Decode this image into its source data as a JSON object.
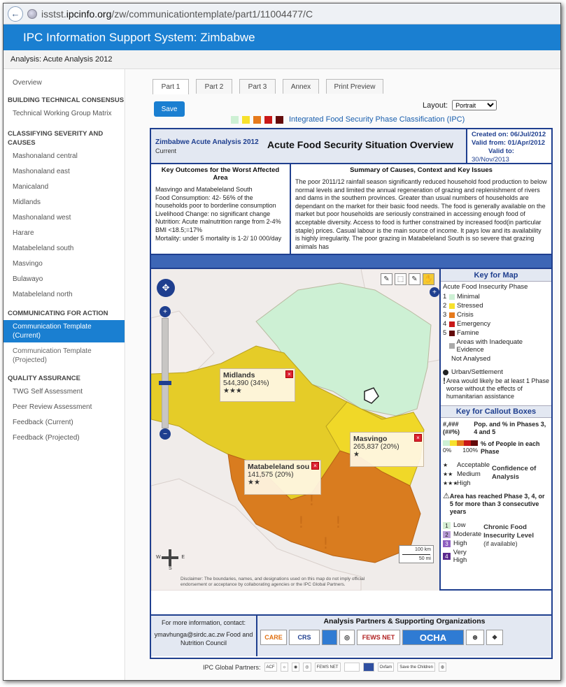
{
  "browser": {
    "url_prefix": "isstst.",
    "url_domain": "ipcinfo.org",
    "url_path": "/zw/communicationtemplate/part1/11004477/C"
  },
  "app": {
    "title": "IPC Information Support System: Zimbabwe",
    "analysis": "Analysis: Acute Analysis 2012"
  },
  "sidebar": {
    "overview": "Overview",
    "sections": [
      {
        "heading": "BUILDING TECHNICAL CONSENSUS",
        "items": [
          "Technical Working Group Matrix"
        ]
      },
      {
        "heading": "CLASSIFYING SEVERITY AND CAUSES",
        "items": [
          "Mashonaland central",
          "Mashonaland east",
          "Manicaland",
          "Midlands",
          "Mashonaland west",
          "Harare",
          "Matabeleland south",
          "Masvingo",
          "Bulawayo",
          "Matabeleland north"
        ]
      },
      {
        "heading": "COMMUNICATING FOR ACTION",
        "active": "Communication Template",
        "active_sub": "(Current)",
        "item2": "Communication Template",
        "item2_sub": "(Projected)"
      },
      {
        "heading": "QUALITY ASSURANCE",
        "items": [
          "TWG Self Assessment",
          "Peer Review Assessment",
          "Feedback (Current)",
          "Feedback (Projected)"
        ]
      }
    ]
  },
  "tabs": [
    "Part 1",
    "Part 2",
    "Part 3",
    "Annex",
    "Print Preview"
  ],
  "save": "Save",
  "layout": {
    "label": "Layout:",
    "value": "Portrait"
  },
  "ipc_title": "Integrated Food Security Phase Classification (IPC)",
  "phase_colors": [
    "#cdf0d4",
    "#f7e12c",
    "#e67a1c",
    "#c91818",
    "#640b0b"
  ],
  "doc": {
    "left_title": "Zimbabwe Acute Analysis 2012",
    "left_sub": "Current",
    "title": "Acute Food Security Situation Overview",
    "created": "Created on: 06/Jul/2012",
    "valid_from": "Valid from: 01/Apr/2012",
    "valid_to": "Valid to:",
    "valid_to_date": "30/Nov/2013",
    "key_outcomes_h": "Key Outcomes for the Worst Affected Area",
    "key_outcomes": [
      "Masvingo and Matabeleland South",
      "Food Consumption: 42- 56% of the households poor to borderline consumption",
      "Livelihood Change: no significant change",
      "Nutrition: Acute malnutrition range from 2-4% BMI <18.5;=17%",
      "Mortality: under 5 mortality is 1-2/ 10 000/day"
    ],
    "summary_h": "Summary of Causes, Context and Key Issues",
    "summary": "The poor 2011/12 rainfall season significantly reduced household food production to below normal levels and limited the annual regeneration of grazing and replenishment of rivers and dams in the southern provinces. Greater than usual numbers of households are dependant on the market for their basic food needs. The food is generally available on the market but poor households are seriously constrained in accessing enough food of acceptable diversity. Access to food is further constrained by increased food(in particular staple) prices. Casual labour is the main source of income. It pays low and its availability is highly irregularity. The poor grazing in Matabeleland South is so severe that grazing animals has"
  },
  "callouts": [
    {
      "name": "Midlands",
      "value": "544,390 (34%)",
      "stars": "★★★"
    },
    {
      "name": "Masvingo",
      "value": "265,837 (20%)",
      "stars": "★"
    },
    {
      "name": "Matabeleland sou ...",
      "value": "141,575 (20%)",
      "stars": "★★"
    }
  ],
  "map": {
    "disclaimer": "Disclaimer: The boundaries, names, and designations used on this map do not imply official endorsement or acceptance by collaborating agencies or the IPC Global Partners.",
    "scale_km": "100 km",
    "scale_mi": "50 mi",
    "compass": {
      "w": "W",
      "e": "E",
      "s": "S"
    }
  },
  "legend": {
    "title": "Key for Map",
    "subtitle": "Acute Food Insecurity Phase",
    "phases": [
      {
        "n": "1",
        "label": "Minimal"
      },
      {
        "n": "2",
        "label": "Stressed"
      },
      {
        "n": "3",
        "label": "Crisis"
      },
      {
        "n": "4",
        "label": "Emergency"
      },
      {
        "n": "5",
        "label": "Famine"
      }
    ],
    "inadequate": "Areas with Inadequate Evidence",
    "not_analysed": "Not Analysed",
    "urban": "Urban/Settlement",
    "worse": "Area would likely be at least 1 Phase worse without the effects of humanitarian assistance",
    "callout_title": "Key for Callout Boxes",
    "pop_code": "#,### (##%)",
    "pop_label": "Pop. and % in Phases 3, 4 and 5",
    "pct_label": "% of People in each Phase",
    "pct_min": "0%",
    "pct_max": "100%",
    "conf": [
      {
        "s": "★",
        "l": "Acceptable"
      },
      {
        "s": "★★",
        "l": "Medium"
      },
      {
        "s": "★★★",
        "l": "High"
      }
    ],
    "conf_label": "Confidence of Analysis",
    "reached": "Area has reached Phase 3, 4, or 5 for more than 3 consecutive years",
    "chronic": [
      {
        "n": "1",
        "l": "Low"
      },
      {
        "n": "2",
        "l": "Moderate"
      },
      {
        "n": "3",
        "l": "High"
      },
      {
        "n": "4",
        "l": "Very High"
      }
    ],
    "chronic_label": "Chronic Food Insecurity Level",
    "chronic_sub": "(if available)"
  },
  "footer": {
    "info": "For more information, contact:",
    "contact": "ymavhunga@sirdc.ac.zw Food and Nutrition Council",
    "partners_h": "Analysis Partners & Supporting Organizations",
    "logos": [
      "CARE",
      "CRS",
      "",
      "",
      "FEWS NET",
      "OCHA",
      "",
      ""
    ],
    "global": "IPC Global Partners:",
    "global_logos": [
      "ACF",
      "",
      "",
      "",
      "FEWS NET",
      "",
      "",
      "Oxfam",
      "Save the Children",
      ""
    ]
  }
}
